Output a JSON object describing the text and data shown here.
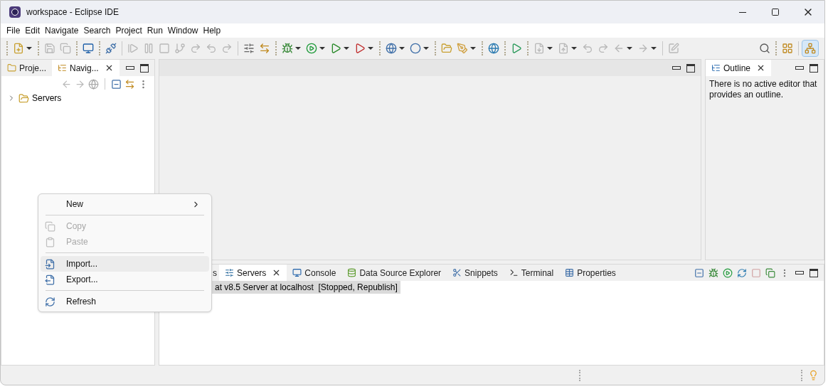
{
  "window": {
    "title": "workspace - Eclipse IDE"
  },
  "menu_bar": [
    "File",
    "Edit",
    "Navigate",
    "Search",
    "Project",
    "Run",
    "Window",
    "Help"
  ],
  "left_view": {
    "tabs": [
      {
        "label": "Proje...",
        "selected": false
      },
      {
        "label": "Navig...",
        "selected": true
      }
    ],
    "tree": [
      {
        "label": "Servers",
        "expanded": false
      }
    ]
  },
  "outline_view": {
    "tabs": [
      {
        "label": "Outline",
        "selected": true
      }
    ],
    "message": "There is no active editor that provides an outline."
  },
  "bottom_view": {
    "tabs": [
      {
        "label": "s",
        "selected": false,
        "kind": "partial"
      },
      {
        "label": "Servers",
        "selected": true,
        "kind": "servers"
      },
      {
        "label": "Console",
        "selected": false,
        "kind": "console"
      },
      {
        "label": "Data Source Explorer",
        "selected": false,
        "kind": "datasource"
      },
      {
        "label": "Snippets",
        "selected": false,
        "kind": "snippets"
      },
      {
        "label": "Terminal",
        "selected": false,
        "kind": "terminal"
      },
      {
        "label": "Properties",
        "selected": false,
        "kind": "properties"
      }
    ],
    "rows": [
      {
        "text": "at v8.5 Server at localhost  [Stopped, Republish]",
        "selected": true
      }
    ]
  },
  "context_menu": [
    {
      "kind": "new",
      "label": "New",
      "submenu": true,
      "disabled": false,
      "highlighted": false
    },
    {
      "kind": "separator"
    },
    {
      "kind": "copy",
      "label": "Copy",
      "submenu": false,
      "disabled": true,
      "highlighted": false
    },
    {
      "kind": "paste",
      "label": "Paste",
      "submenu": false,
      "disabled": true,
      "highlighted": false
    },
    {
      "kind": "separator"
    },
    {
      "kind": "import",
      "label": "Import...",
      "submenu": false,
      "disabled": false,
      "highlighted": true
    },
    {
      "kind": "export",
      "label": "Export...",
      "submenu": false,
      "disabled": false,
      "highlighted": false
    },
    {
      "kind": "separator"
    },
    {
      "kind": "refresh",
      "label": "Refresh",
      "submenu": false,
      "disabled": false,
      "highlighted": false
    }
  ]
}
